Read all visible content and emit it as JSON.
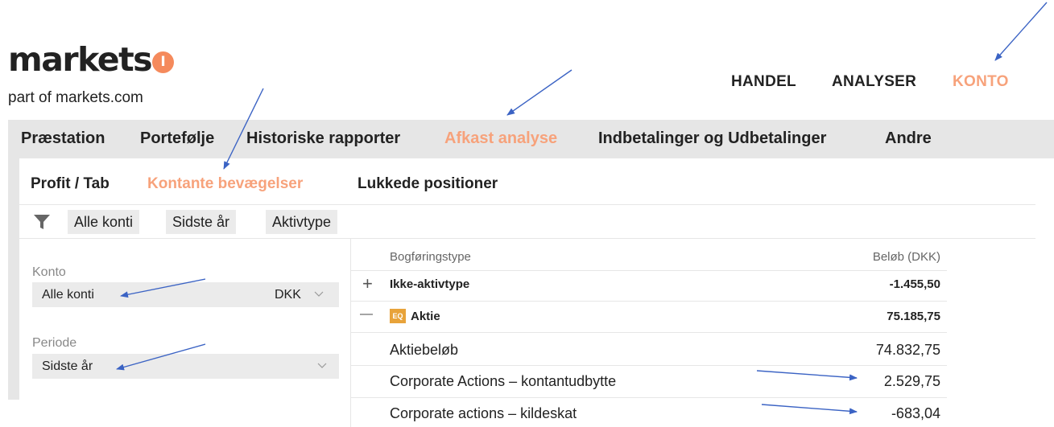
{
  "brand": {
    "name": "markets",
    "icon_letter": "I",
    "tagline": "part of markets.com"
  },
  "top_nav": {
    "items": [
      "HANDEL",
      "ANALYSER",
      "KONTO"
    ],
    "active": "KONTO"
  },
  "main_tabs": {
    "items": [
      "Præstation",
      "Portefølje",
      "Historiske rapporter",
      "Afkast analyse",
      "Indbetalinger og Udbetalinger",
      "Andre"
    ],
    "active": "Afkast analyse"
  },
  "sub_tabs": {
    "items": [
      "Profit / Tab",
      "Kontante bevægelser",
      "Lukkede positioner"
    ],
    "active": "Kontante bevægelser"
  },
  "filter_bar": {
    "icon": "filter-icon",
    "chips": [
      "Alle konti",
      "Sidste år",
      "Aktivtype"
    ]
  },
  "filters": {
    "konto": {
      "label": "Konto",
      "value": "Alle konti",
      "currency": "DKK"
    },
    "periode": {
      "label": "Periode",
      "value": "Sidste år"
    }
  },
  "table": {
    "headers": {
      "type": "Bogføringstype",
      "amount": "Beløb (DKK)"
    },
    "groups": [
      {
        "expander": "+",
        "name": "Ikke-aktivtype",
        "amount": "-1.455,50"
      },
      {
        "expander": "—",
        "badge": "EQ",
        "name": "Aktie",
        "amount": "75.185,75"
      }
    ],
    "rows": [
      {
        "name": "Aktiebeløb",
        "amount": "74.832,75"
      },
      {
        "name": "Corporate Actions – kontantudbytte",
        "amount": "2.529,75"
      },
      {
        "name": "Corporate actions – kildeskat",
        "amount": "-683,04"
      }
    ]
  },
  "colors": {
    "accent": "#f7a27b",
    "brand_orange": "#f58a5c",
    "nav_bg": "#e6e6e6",
    "arrow": "#3b63c4",
    "badge": "#e8a33a"
  }
}
